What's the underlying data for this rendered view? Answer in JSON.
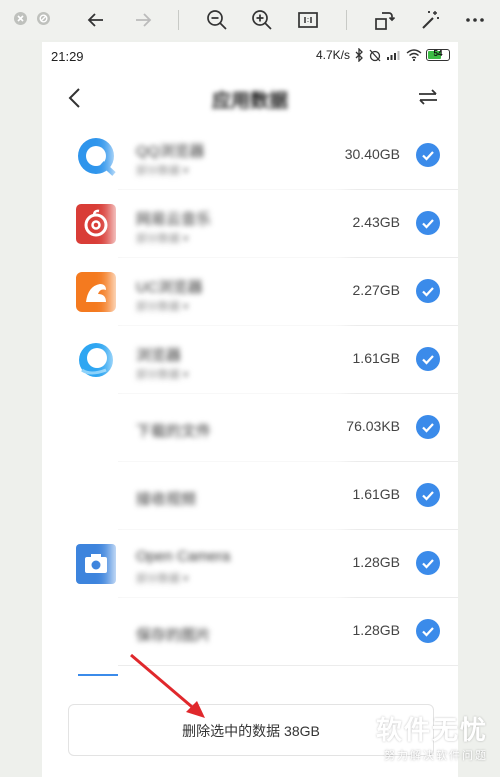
{
  "status_bar": {
    "time": "21:29",
    "speed": "4.7K/s",
    "battery": "54"
  },
  "nav": {
    "title": "应用数据"
  },
  "rows": [
    {
      "name": "QQ浏览器",
      "sub": "部分数据 ▾",
      "size": "30.40GB"
    },
    {
      "name": "网易云音乐",
      "sub": "部分数据 ▾",
      "size": "2.43GB"
    },
    {
      "name": "UC浏览器",
      "sub": "部分数据 ▾",
      "size": "2.27GB"
    },
    {
      "name": "浏览器",
      "sub": "部分数据 ▾",
      "size": "1.61GB"
    },
    {
      "name": "下载的文件",
      "sub": "",
      "size": "76.03KB"
    },
    {
      "name": "接收视频",
      "sub": "",
      "size": "1.61GB"
    },
    {
      "name": "Open Camera",
      "sub": "部分数据 ▾",
      "size": "1.28GB"
    },
    {
      "name": "保存的图片",
      "sub": "",
      "size": "1.28GB"
    }
  ],
  "delete_button": {
    "label": "删除选中的数据 38GB"
  },
  "watermark": {
    "main": "软件无忧",
    "sub": "努力解决软件问题"
  },
  "colors": {
    "accent": "#3b8bea",
    "arrow": "#e0282c"
  }
}
